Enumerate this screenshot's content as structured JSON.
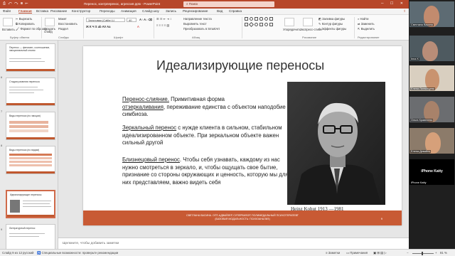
{
  "titlebar": {
    "left_text": "⎙ ↶ ↷ ⊞ ⇤",
    "title": "Перенос, контрперенос, агрессия.pptx  -  PowerPoint",
    "search_placeholder": "Поиск",
    "window_controls": "─ ☐ ✕"
  },
  "tabs": [
    "Файл",
    "Главная",
    "Вставка",
    "Рисование",
    "Конструктор",
    "Переходы",
    "Анимация",
    "Слайд-шоу",
    "Запись",
    "Рецензирование",
    "Вид",
    "Справка"
  ],
  "active_tab": "Главная",
  "ribbon": {
    "clipboard": {
      "cut": "Вырезать",
      "copy": "Копировать",
      "format": "Формат по образцу",
      "paste": "Вставить",
      "label": "Буфер обмена"
    },
    "slides": {
      "new": "Создать слайд",
      "layout": "Макет",
      "reset": "Восстановить",
      "section": "Раздел",
      "label": "Слайды"
    },
    "font": {
      "face": "Заголовки (Calibri Li",
      "size": "40",
      "label": "Шрифт"
    },
    "paragraph": {
      "direction": "Направление текста",
      "align": "Выровнять текст",
      "smartart": "Преобразовать в SmartArt",
      "label": "Абзац"
    },
    "drawing": {
      "arrange": "Упорядочить",
      "quick": "Экспресс-стили",
      "fill": "Заливка фигуры",
      "outline": "Контур фигуры",
      "effects": "Эффекты фигуры",
      "label": "Рисование"
    },
    "editing": {
      "find": "Найти",
      "replace": "Заменить",
      "select": "Выделить",
      "label": "Редактирование"
    }
  },
  "thumbnails": [
    {
      "num": "5",
      "title": "Перенос — феномен, соотношение, эмоциональный отклик"
    },
    {
      "num": "6",
      "title": "Стадии развития переноса"
    },
    {
      "num": "7",
      "title": "Виды переноса (по эмоции)"
    },
    {
      "num": "8",
      "title": "Виды переноса (по видам)"
    },
    {
      "num": "9",
      "title": "Идеализирующие переносы"
    },
    {
      "num": "10",
      "title": "Литературный перенос"
    }
  ],
  "slide": {
    "title": "Идеализирующие переносы",
    "b1_term": "Перенос-слияние.",
    "b1_rest": " Примитивная форма",
    "b1_term2": "отзеркаливания",
    "b1_rest2": ", переживание единства с объектом наподобие симбиоза.",
    "b2_term": "Зеркальный перенос",
    "b2_rest": " с нужде клиента в сильном, стабильном идеализированном объекте. При зеркальном объекте важен сильный другой",
    "b3_term": "Близнецовый перенос",
    "b3_rest": ". Чтобы себя узнавать, каждому из нас нужно смотреться в зеркало, и, чтобы ощущать свое бытие, признание со стороны окружающих и ценность, которую мы для них представляем, важно видеть себя",
    "photo_caption": "Heinz Kohut  1913 —1981",
    "footer_line1": "СВЕТЛАНА ВАСИНА. ОПТ-АДВАЙЗЕР, СУПЕРВИЗОР, ПОЛИМЕДАЛЬНЫЙ ПСИХОТЕРАПЕВТ",
    "footer_line2": "(БАЗОВАЯ МОДАЛЬНОСТЬ: ПСИХОАНАЛИЗ)",
    "page_number": "9"
  },
  "notes_placeholder": "Щелкните, чтобы добавить заметки",
  "status": {
    "slide_info": "Слайд 9 из 12",
    "language": "русский",
    "accessibility": "Специальные возможности: проверьте рекомендации",
    "notes_btn": "Заметки",
    "comments_btn": "Примечания",
    "zoom": "81 %"
  },
  "participants": [
    {
      "name": "Светлана Васина",
      "color": "#8a6a5a"
    },
    {
      "name": "Inna K",
      "color": "#6b7d8c"
    },
    {
      "name": "Елена Литвинцева",
      "color": "#a07a60"
    },
    {
      "name": "Ольга Кравелева",
      "color": "#7a6a5a"
    },
    {
      "name": "Елена Девайлэ",
      "color": "#c09070"
    },
    {
      "name": "iPhone Katty",
      "color": "#000000"
    }
  ],
  "tile_center": "iPhone Katty"
}
